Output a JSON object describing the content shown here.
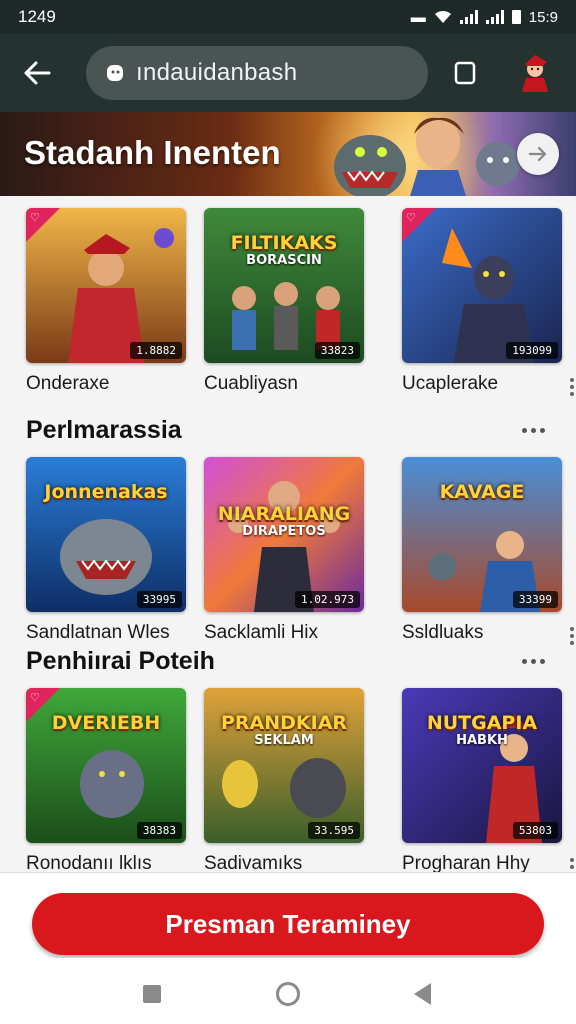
{
  "status_bar": {
    "time": "1249",
    "right_time": "15:9"
  },
  "toolbar": {
    "url": "ındauidanbash"
  },
  "banner": {
    "title": "Stadanh Inenten"
  },
  "sections": [
    {
      "title": "",
      "games": [
        {
          "label": "Onderaxe",
          "thumb_title": "",
          "thumb_sub": "",
          "count": "1.8882",
          "badge": true
        },
        {
          "label": "Cuabliyasn",
          "thumb_title": "FILTIKAKS",
          "thumb_sub": "BORASCIN",
          "count": "33823",
          "badge": false
        },
        {
          "label": "Ucaplerake",
          "thumb_title": "",
          "thumb_sub": "",
          "count": "193099",
          "badge": true
        }
      ]
    },
    {
      "title": "Perlmarassia",
      "games": [
        {
          "label": "Sandlatnan Wles",
          "thumb_title": "Jonnenakas",
          "thumb_sub": "",
          "count": "33995",
          "badge": false
        },
        {
          "label": "Sacklamli Hix",
          "thumb_title": "NIARALIANG",
          "thumb_sub": "DIRAPETOS",
          "count": "1.02.973",
          "badge": false
        },
        {
          "label": "Ssldluaks",
          "thumb_title": "KAVAGE",
          "thumb_sub": "",
          "count": "33399",
          "badge": false
        }
      ]
    },
    {
      "title": "Penhiırai Poteih",
      "games": [
        {
          "label": "Ronodanıı lklıs",
          "thumb_title": "DVERIEBH",
          "thumb_sub": "",
          "count": "38383",
          "badge": true
        },
        {
          "label": "Sadivamıks",
          "thumb_title": "PRANDKIAR",
          "thumb_sub": "SEKLAM",
          "count": "33.595",
          "badge": false
        },
        {
          "label": "Progharan Hhy",
          "thumb_title": "NUTGAPIA",
          "thumb_sub": "HABKH",
          "count": "53803",
          "badge": false
        }
      ]
    }
  ],
  "cta": {
    "label": "Presman Teraminey"
  },
  "colors": {
    "accent": "#d8181d",
    "topbar": "#243230",
    "badge": "#e0245e"
  }
}
